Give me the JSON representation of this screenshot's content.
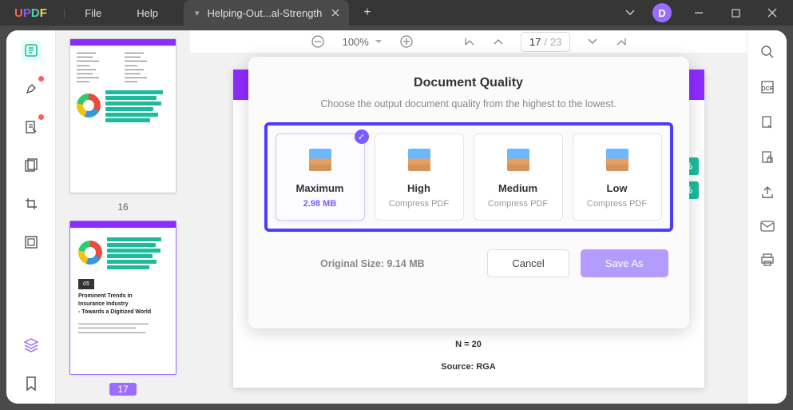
{
  "titlebar": {
    "logo": {
      "u": "U",
      "p": "P",
      "d": "D",
      "f": "F"
    },
    "menu": {
      "file": "File",
      "help": "Help"
    },
    "tab_title": "Helping-Out...al-Strength",
    "avatar_letter": "D"
  },
  "toolbar": {
    "zoom": "100%",
    "page_current": "17",
    "page_sep": "/",
    "page_total": "23"
  },
  "thumbnails": {
    "page16_label": "16",
    "page17_label": "17",
    "page17": {
      "box": "05",
      "h1": "Prominent Trends in",
      "h2": "Insurance Industry",
      "h3": "- Towards a Digitized World"
    }
  },
  "page": {
    "n20": "N = 20",
    "source": "Source: RGA",
    "badge1": "3%",
    "badge2": "3%"
  },
  "modal": {
    "title": "Document Quality",
    "subtitle": "Choose the output document quality from the highest to the lowest.",
    "options": [
      {
        "title": "Maximum",
        "sub": "2.98 MB"
      },
      {
        "title": "High",
        "sub": "Compress PDF"
      },
      {
        "title": "Medium",
        "sub": "Compress PDF"
      },
      {
        "title": "Low",
        "sub": "Compress PDF"
      }
    ],
    "original_size": "Original Size: 9.14 MB",
    "cancel": "Cancel",
    "save_as": "Save As"
  }
}
